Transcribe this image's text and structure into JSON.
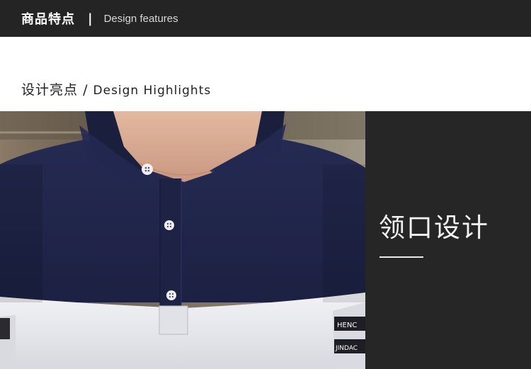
{
  "header": {
    "title_cn": "商品特点",
    "separator": "|",
    "title_en": "Design features"
  },
  "section": {
    "title_cn": "设计亮点",
    "separator": "/",
    "title_en": "Design Highlights"
  },
  "feature": {
    "title": "领口设计"
  },
  "sleeve_text": {
    "upper": "HENC",
    "lower": "JINDAC"
  },
  "colors": {
    "header_bg": "#242424",
    "panel_bg": "#262626",
    "shirt_navy": "#1f2447",
    "shirt_white": "#e9e9ee"
  }
}
